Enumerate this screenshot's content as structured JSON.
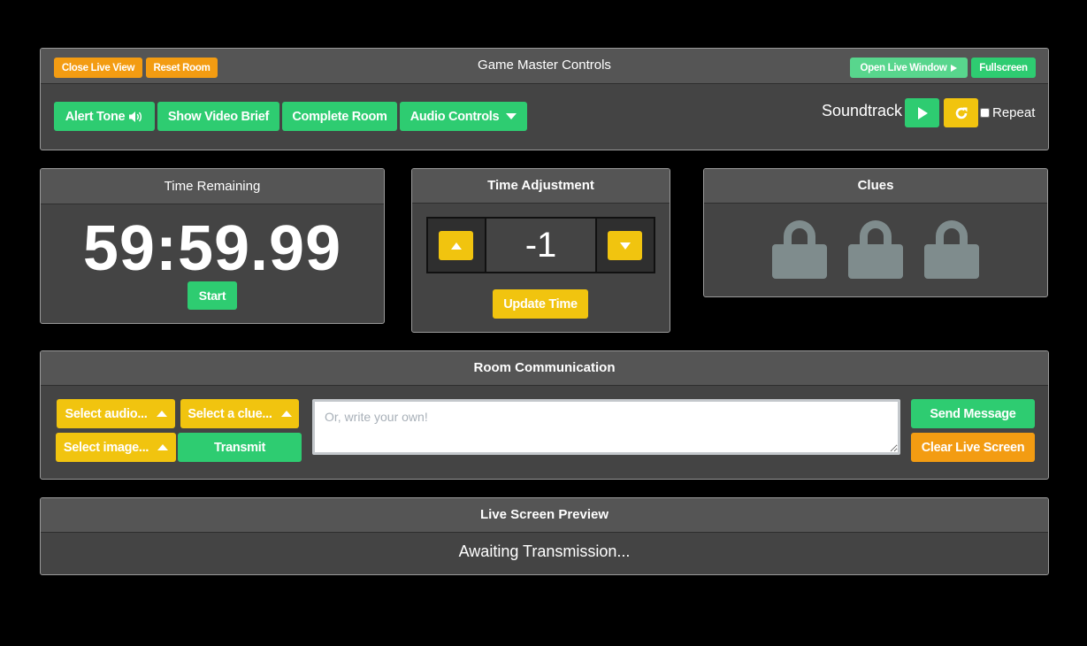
{
  "game_master": {
    "title": "Game Master Controls",
    "close_live_view": "Close Live View",
    "reset_room": "Reset Room",
    "open_live_window": "Open Live Window",
    "fullscreen": "Fullscreen",
    "alert_tone": "Alert Tone",
    "show_video_brief": "Show Video Brief",
    "complete_room": "Complete Room",
    "audio_controls": "Audio Controls",
    "soundtrack_label": "Soundtrack",
    "repeat_label": "Repeat",
    "repeat_checked": false
  },
  "time_remaining": {
    "title": "Time Remaining",
    "timer": "59:59.99",
    "start": "Start"
  },
  "time_adjustment": {
    "title": "Time Adjustment",
    "value": "-1",
    "update": "Update Time"
  },
  "clues": {
    "title": "Clues",
    "locks": [
      {
        "icon": "lock-icon",
        "state": "locked"
      },
      {
        "icon": "lock-icon",
        "state": "locked"
      },
      {
        "icon": "lock-icon",
        "state": "locked"
      }
    ]
  },
  "room_communication": {
    "title": "Room Communication",
    "select_audio": "Select audio...",
    "select_clue": "Select a clue...",
    "select_image": "Select image...",
    "transmit": "Transmit",
    "message_placeholder": "Or, write your own!",
    "message_value": "",
    "send_message": "Send Message",
    "clear_live_screen": "Clear Live Screen"
  },
  "live_preview": {
    "title": "Live Screen Preview",
    "status": "Awaiting Transmission..."
  },
  "colors": {
    "green": "#2ecc71",
    "green_light": "#58d68d",
    "orange": "#f39c12",
    "yellow": "#f1c40f",
    "panel": "#444444",
    "panel_header": "#555555",
    "lock": "#7f8c8d"
  }
}
